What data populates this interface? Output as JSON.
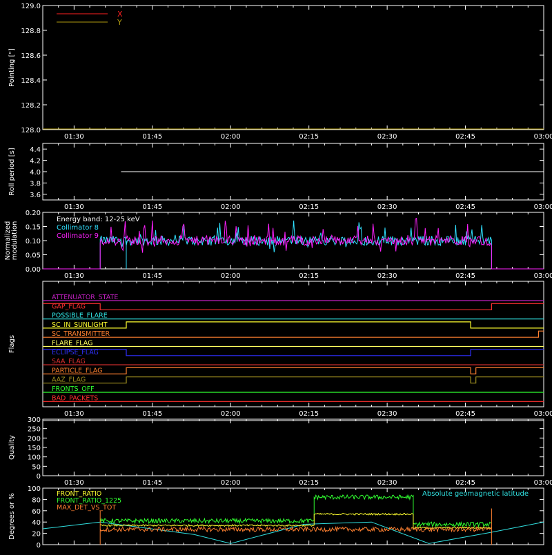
{
  "x_ticks": [
    "01:30",
    "01:45",
    "02:00",
    "02:15",
    "02:30",
    "02:45",
    "03:00"
  ],
  "chart_data": [
    {
      "type": "line",
      "ylabel": "Pointing [\"]",
      "ylim": [
        128.0,
        129.0
      ],
      "y_ticks": [
        "128.0",
        "128.2",
        "128.4",
        "128.6",
        "128.8",
        "129.0"
      ],
      "legend": [
        {
          "name": "X",
          "color": "#ff2020"
        },
        {
          "name": "Y",
          "color": "#b09a10"
        }
      ]
    },
    {
      "type": "line",
      "ylabel": "Roll period [s]",
      "ylim": [
        3.5,
        4.5
      ],
      "y_ticks": [
        "3.6",
        "3.8",
        "4.0",
        "4.2",
        "4.4"
      ],
      "series": [
        {
          "color": "#ffffff",
          "x_start": "01:39",
          "x_end": "03:00",
          "value": 4.0
        }
      ]
    },
    {
      "type": "line",
      "ylabel": "Normalized modulation",
      "ylim": [
        0.0,
        0.2
      ],
      "y_ticks": [
        "0.00",
        "0.05",
        "0.10",
        "0.15",
        "0.20"
      ],
      "annotation": "Energy band: 12-25 keV",
      "legend": [
        {
          "name": "Collimator 8",
          "color": "#30e0ff"
        },
        {
          "name": "Collimator 9",
          "color": "#ff20ff"
        }
      ],
      "active_range": [
        "01:35",
        "02:50"
      ],
      "mean_value": 0.1
    },
    {
      "type": "line",
      "ylabel": "Flags",
      "flags": [
        {
          "name": "ATTENUATOR_STATE",
          "color": "#c020c0",
          "segments": [
            [
              "01:24",
              "03:00",
              0
            ]
          ]
        },
        {
          "name": "GAP_FLAG",
          "color": "#ff3030",
          "segments": [
            [
              "01:24",
              "01:35",
              1
            ],
            [
              "01:35",
              "02:50",
              0
            ],
            [
              "02:50",
              "03:00",
              1
            ]
          ]
        },
        {
          "name": "POSSIBLE_FLARE",
          "color": "#30e0e0",
          "segments": [
            [
              "01:24",
              "03:00",
              0
            ]
          ]
        },
        {
          "name": "SC_IN_SUNLIGHT",
          "color": "#ffff30",
          "segments": [
            [
              "01:24",
              "01:40",
              0
            ],
            [
              "01:40",
              "02:46",
              1
            ],
            [
              "02:46",
              "03:00",
              0
            ]
          ]
        },
        {
          "name": "SC_TRANSMITTER",
          "color": "#ff8030",
          "segments": [
            [
              "01:24",
              "02:59",
              0
            ],
            [
              "02:59",
              "03:00",
              1
            ]
          ]
        },
        {
          "name": "FLARE_FLAG",
          "color": "#ffff60",
          "segments": [
            [
              "01:24",
              "03:00",
              0
            ]
          ]
        },
        {
          "name": "ECLIPSE_FLAG",
          "color": "#3030ff",
          "segments": [
            [
              "01:24",
              "01:40",
              1
            ],
            [
              "01:40",
              "02:46",
              0
            ],
            [
              "02:46",
              "03:00",
              1
            ]
          ]
        },
        {
          "name": "SAA_FLAG",
          "color": "#e03030",
          "segments": [
            [
              "01:24",
              "03:00",
              0
            ]
          ]
        },
        {
          "name": "PARTICLE_FLAG",
          "color": "#ff8030",
          "segments": [
            [
              "01:24",
              "01:40",
              0
            ],
            [
              "01:40",
              "02:46",
              1
            ],
            [
              "02:46",
              "02:47",
              0
            ],
            [
              "02:47",
              "03:00",
              1
            ]
          ]
        },
        {
          "name": "AAZ_FLAG",
          "color": "#a09020",
          "segments": [
            [
              "01:24",
              "01:40",
              0
            ],
            [
              "01:40",
              "02:46",
              1
            ],
            [
              "02:46",
              "02:47",
              0
            ],
            [
              "02:47",
              "03:00",
              1
            ]
          ]
        },
        {
          "name": "FRONTS_OFF",
          "color": "#30ff30",
          "segments": [
            [
              "01:24",
              "03:00",
              0
            ]
          ]
        },
        {
          "name": "BAD_PACKETS",
          "color": "#ff3030",
          "segments": [
            [
              "01:24",
              "03:00",
              0
            ]
          ]
        }
      ]
    },
    {
      "type": "line",
      "ylabel": "Quality",
      "ylim": [
        0,
        300
      ],
      "y_ticks": [
        "0",
        "50",
        "100",
        "150",
        "200",
        "250",
        "300"
      ]
    },
    {
      "type": "line",
      "ylabel": "Degrees or %",
      "ylim": [
        0,
        100
      ],
      "y_ticks": [
        "0",
        "20",
        "40",
        "60",
        "80",
        "100"
      ],
      "legend": [
        {
          "name": "FRONT_RATIO",
          "color": "#ffff30"
        },
        {
          "name": "FRONT_RATIO_1225",
          "color": "#30ff30"
        },
        {
          "name": "MAX_DET_VS_TOT",
          "color": "#ff8030"
        }
      ],
      "latitude_label": "Absolute geomagnetic latitude",
      "latitude_color": "#30e0e0",
      "series": [
        {
          "name": "FRONT_RATIO_1225",
          "levels": [
            [
              "01:35",
              "02:16",
              42
            ],
            [
              "02:16",
              "02:35",
              84
            ],
            [
              "02:35",
              "02:50",
              36
            ]
          ]
        },
        {
          "name": "FRONT_RATIO",
          "levels": [
            [
              "01:35",
              "02:16",
              34
            ],
            [
              "02:16",
              "02:35",
              54
            ],
            [
              "02:35",
              "02:50",
              30
            ]
          ]
        },
        {
          "name": "MAX_DET_VS_TOT",
          "levels": [
            [
              "01:35",
              "02:50",
              27
            ]
          ]
        }
      ],
      "latitude": {
        "x": [
          "01:24",
          "01:35",
          "01:53",
          "02:00",
          "02:14",
          "02:27",
          "02:38",
          "02:50",
          "03:00"
        ],
        "y": [
          28,
          40,
          18,
          2,
          36,
          40,
          2,
          22,
          40
        ]
      }
    }
  ]
}
